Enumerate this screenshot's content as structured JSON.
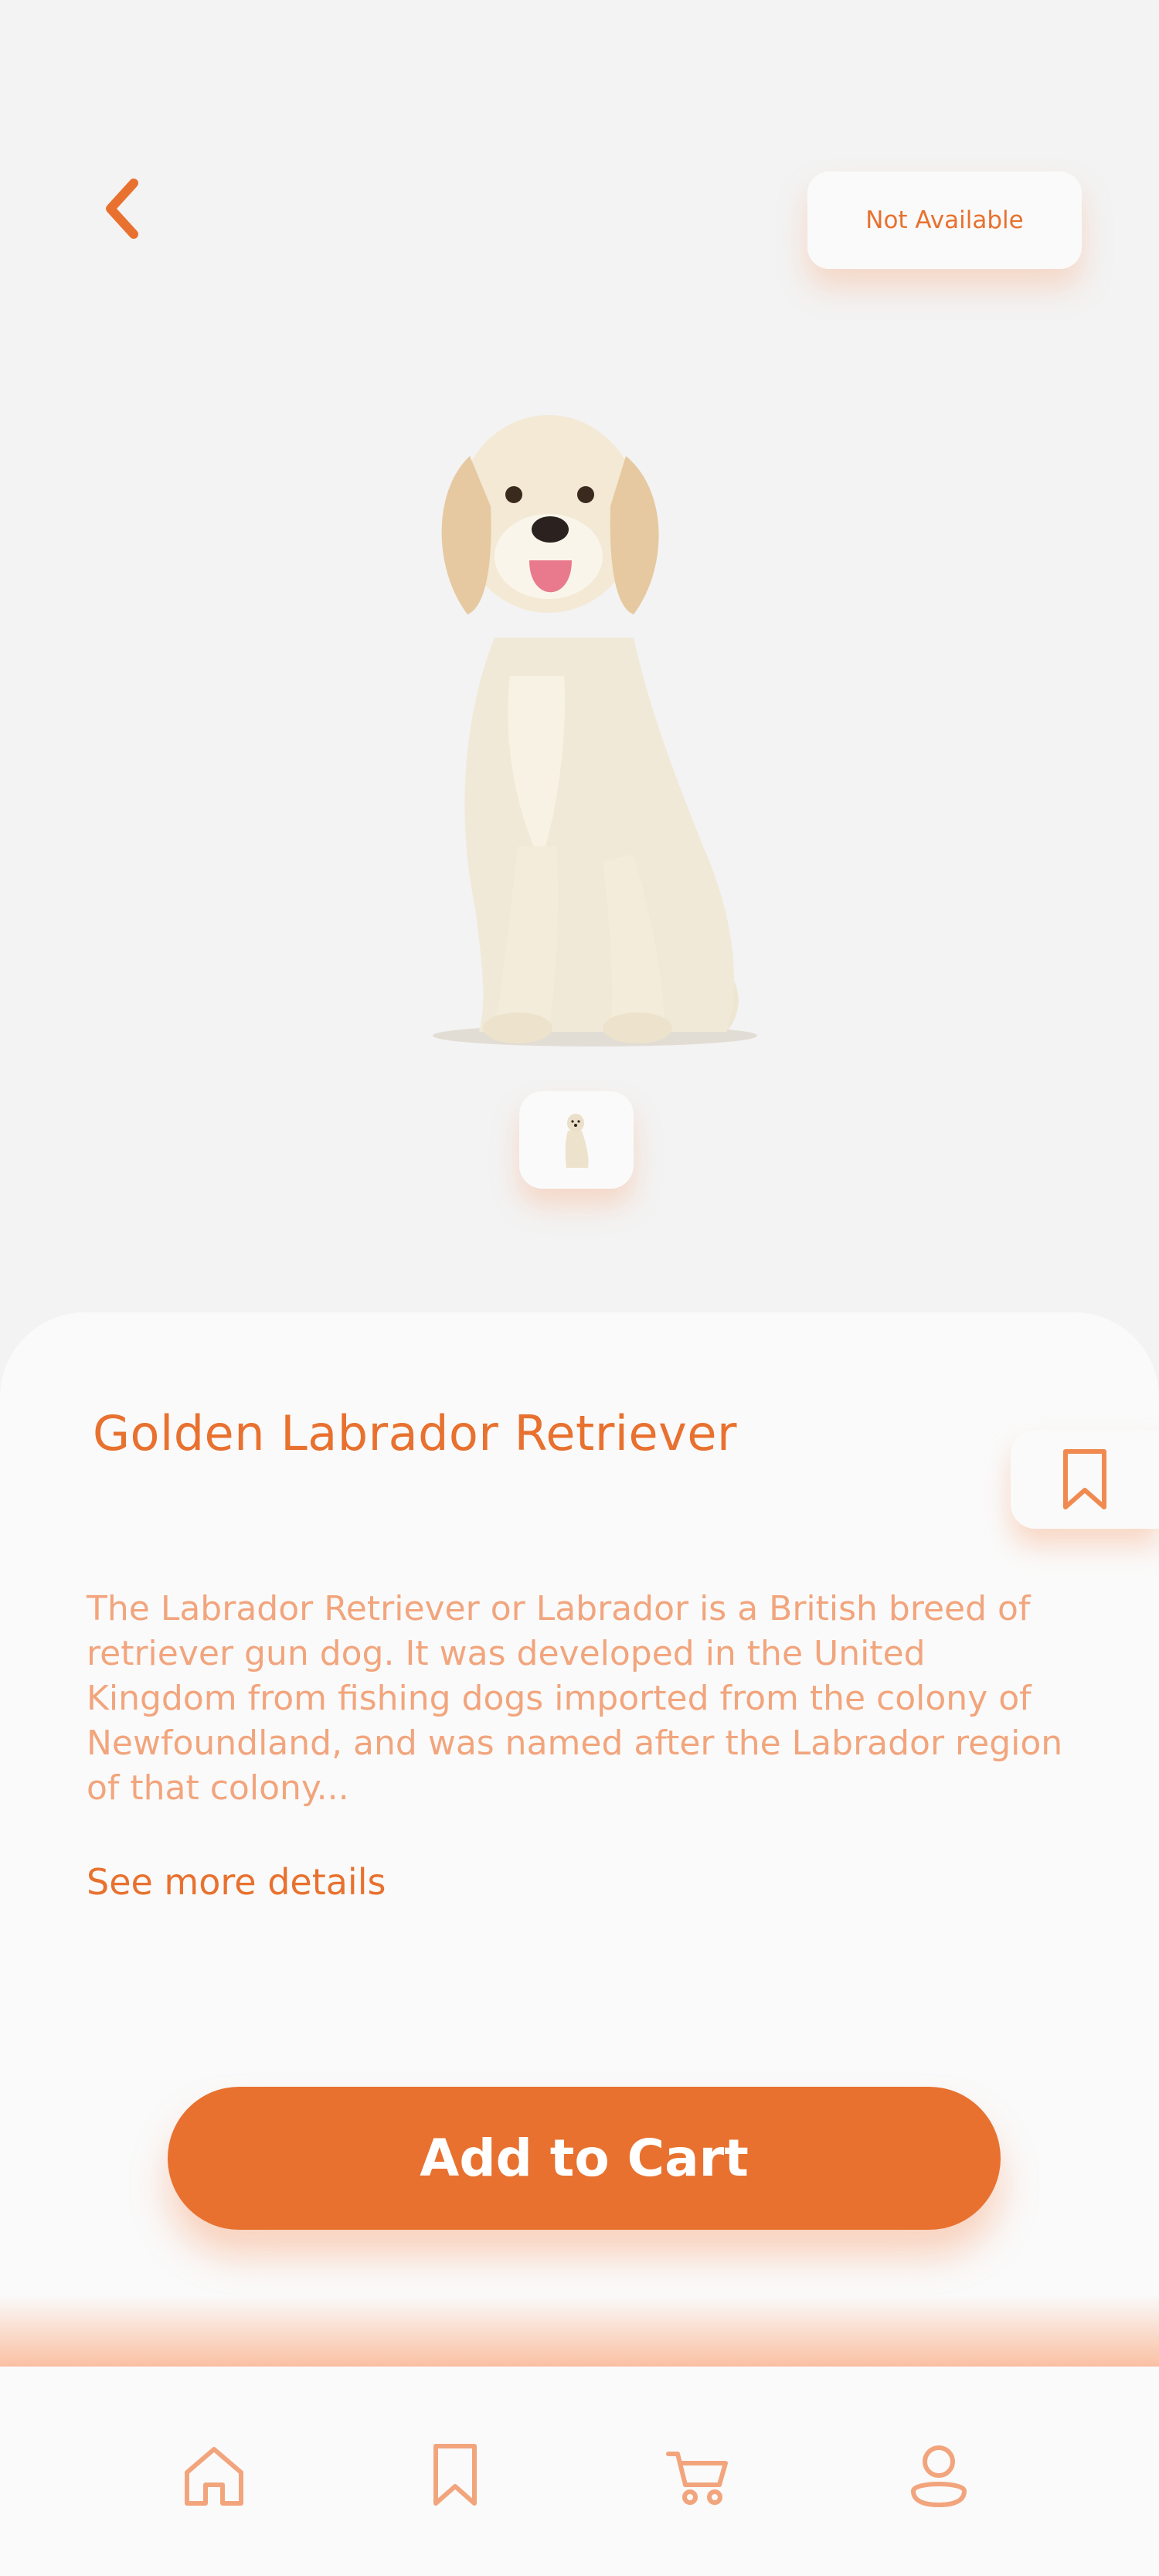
{
  "header": {
    "status_label": "Not Available"
  },
  "product": {
    "title": "Golden Labrador Retriever",
    "description": "The Labrador Retriever or Labrador is a British breed of retriever gun dog. It was developed in the United Kingdom from fishing dogs imported from the colony of Newfoundland, and was named after the Labrador region of that colony...",
    "see_more_label": "See more details"
  },
  "actions": {
    "add_to_cart_label": "Add to Cart"
  },
  "icons": {
    "back": "chevron-left-icon",
    "bookmark": "bookmark-icon",
    "nav": [
      "home-icon",
      "bookmark-icon",
      "cart-icon",
      "profile-icon"
    ]
  },
  "colors": {
    "accent": "#E8712F",
    "accent_light": "#F2A57D",
    "background": "#F3F3F3",
    "surface": "#FAFAFA"
  }
}
